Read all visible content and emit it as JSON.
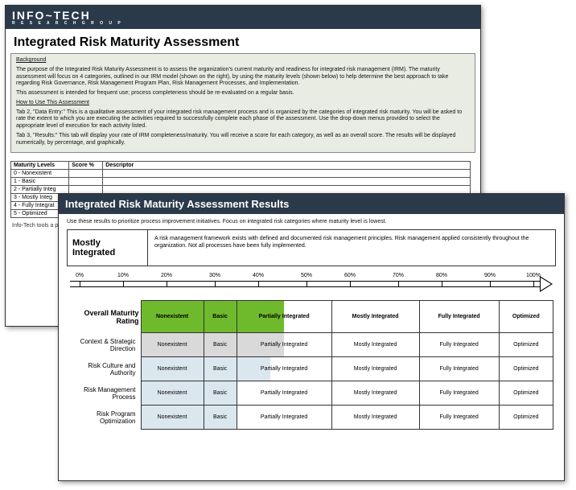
{
  "brand": {
    "name": "INFO~TECH",
    "sub": "R E S E A R C H   G R O U P"
  },
  "doc1": {
    "title": "Integrated Risk Maturity Assessment",
    "bg_heading": "Background",
    "bg_p1": "The purpose of the Integrated Risk Maturity Assessment is to assess the organization's current maturity and readiness for integrated risk management (IRM). The maturity assessment will focus on 4 categories, outlined in our IRM model (shown on the right), by using the maturity levels (shown below) to help determine the best approach to take regarding Risk Governance, Risk Management Program Plan, Risk Management Processes, and Implementation.",
    "bg_p2": "This assessment is intended for frequent use; process completeness should be re-evaluated on a regular basis.",
    "howto_heading": "How to Use This Assessment",
    "howto_p1": "Tab 2, \"Data Entry:\" This is a qualitative assessment of your integrated risk management process and is organized by the categories of integrated risk maturity. You will be asked to rate the extent to which you are executing the activities required to successfully complete each phase of the assessment. Use the drop-down menus provided to select the appropriate level of execution for each activity listed.",
    "howto_p2": "Tab 3, \"Results:\" This tab will display your rate of IRM completeness/maturity. You will receive a score for each category, as well as an overall score. The results will be displayed numerically, by percentage, and graphically.",
    "ml_headers": [
      "Maturity Levels",
      "Score %",
      "Descriptor"
    ],
    "ml_rows": [
      "0 - Nonexistent",
      "1 - Basic",
      "2 - Partially Integ",
      "3 - Mostly Integ",
      "4 - Fully Integrat",
      "5 - Optimized"
    ],
    "footnote": "Info-Tech tools a\nprofessional or d\ncreation. To cus"
  },
  "doc2": {
    "title": "Integrated Risk Maturity Assessment Results",
    "subtext": "Use these results to prioritize process improvement initiatives. Focus on integrated risk categories where maturity level is lowest.",
    "summary_level": "Mostly Integrated",
    "summary_desc": "A risk management framework exists with defined and documented risk management principles. Risk management applied consistently throughout the organization. Not all processes have been fully implemented.",
    "ticks": [
      "0%",
      "10%",
      "20%",
      "30%",
      "40%",
      "50%",
      "60%",
      "70%",
      "80%",
      "90%",
      "100%"
    ],
    "col_labels": [
      "Nonexistent",
      "Basic",
      "Partially Integrated",
      "Mostly Integrated",
      "Fully Integrated",
      "Optimized"
    ],
    "row_header": "Overall Maturity Rating",
    "rows": [
      "Context & Strategic Direction",
      "Risk Culture and Authority",
      "Risk Management Process",
      "Risk Program Optimization"
    ]
  },
  "chart_data": {
    "type": "table",
    "title": "Overall Maturity Rating",
    "xlabel": "",
    "ylabel": "",
    "categories": [
      "Nonexistent",
      "Basic",
      "Partially Integrated",
      "Mostly Integrated",
      "Fully Integrated",
      "Optimized"
    ],
    "series": [
      {
        "name": "Overall Maturity Rating",
        "value": 2.5,
        "label": "Partially Integrated (50%)"
      },
      {
        "name": "Context & Strategic Direction",
        "value": 2.5,
        "label": "Partially Integrated"
      },
      {
        "name": "Risk Culture and Authority",
        "value": 2.3,
        "label": "Partially Integrated"
      },
      {
        "name": "Risk Management Process",
        "value": 2.0,
        "label": "Partially Integrated"
      },
      {
        "name": "Risk Program Optimization",
        "value": 2.0,
        "label": "Partially Integrated"
      }
    ],
    "legend": {
      "green": "Overall score fill",
      "grey": "Context & Strategic Direction fill",
      "ltblue": "Category score fill"
    },
    "scale_percent": [
      0,
      10,
      20,
      30,
      40,
      50,
      60,
      70,
      80,
      90,
      100
    ]
  }
}
